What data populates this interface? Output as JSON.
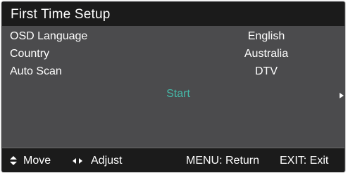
{
  "title": "First Time Setup",
  "menu": {
    "items": [
      {
        "label": "OSD Language",
        "value": "English"
      },
      {
        "label": "Country",
        "value": "Australia"
      },
      {
        "label": "Auto Scan",
        "value": "DTV"
      }
    ],
    "start_label": "Start"
  },
  "footer": {
    "move_label": "Move",
    "adjust_label": "Adjust",
    "menu_hint": "MENU: Return",
    "exit_hint": "EXIT: Exit"
  },
  "icons": {
    "move": "up-down-arrows-icon",
    "adjust": "left-right-arrows-icon",
    "next": "right-arrow-icon"
  },
  "colors": {
    "title_bar": "#1b1b1b",
    "panel": "#4b4b4d",
    "highlight": "#45b9a9",
    "text": "#ffffff"
  }
}
